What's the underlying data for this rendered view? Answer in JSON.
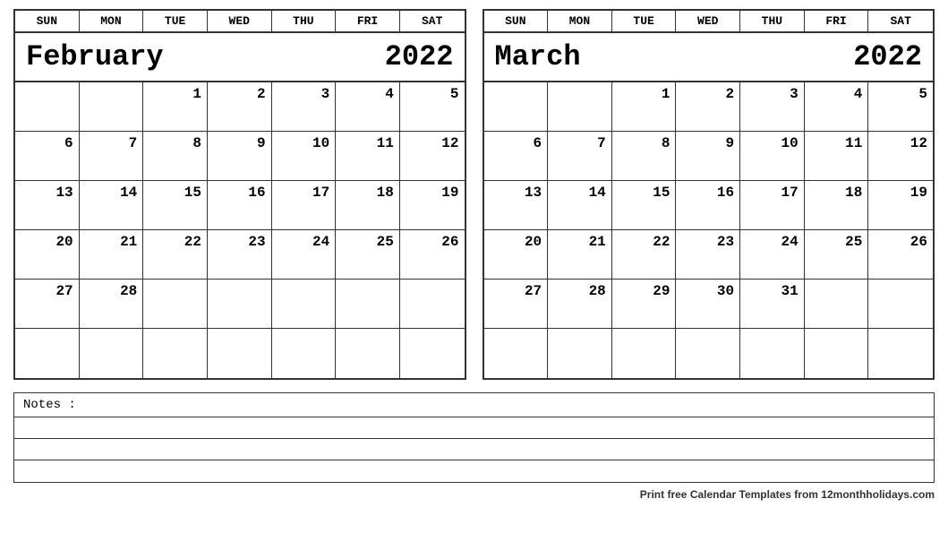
{
  "february": {
    "month_name": "February",
    "year": "2022",
    "days": [
      "SUN",
      "MON",
      "TUE",
      "WED",
      "THU",
      "FRI",
      "SAT"
    ],
    "weeks": [
      [
        "",
        "",
        "1",
        "2",
        "3",
        "4",
        "5"
      ],
      [
        "6",
        "7",
        "8",
        "9",
        "10",
        "11",
        "12"
      ],
      [
        "13",
        "14",
        "15",
        "16",
        "17",
        "18",
        "19"
      ],
      [
        "20",
        "21",
        "22",
        "23",
        "24",
        "25",
        "26"
      ],
      [
        "27",
        "28",
        "",
        "",
        "",
        "",
        ""
      ],
      [
        "",
        "",
        "",
        "",
        "",
        "",
        ""
      ]
    ]
  },
  "march": {
    "month_name": "March",
    "year": "2022",
    "days": [
      "SUN",
      "MON",
      "TUE",
      "WED",
      "THU",
      "FRI",
      "SAT"
    ],
    "weeks": [
      [
        "",
        "",
        "1",
        "2",
        "3",
        "4",
        "5"
      ],
      [
        "6",
        "7",
        "8",
        "9",
        "10",
        "11",
        "12"
      ],
      [
        "13",
        "14",
        "15",
        "16",
        "17",
        "18",
        "19"
      ],
      [
        "20",
        "21",
        "22",
        "23",
        "24",
        "25",
        "26"
      ],
      [
        "27",
        "28",
        "29",
        "30",
        "31",
        "",
        ""
      ],
      [
        "",
        "",
        "",
        "",
        "",
        "",
        ""
      ]
    ]
  },
  "notes_label": "Notes :",
  "footer_text": "Print free Calendar Templates from ",
  "footer_site": "12monthholidays.com"
}
